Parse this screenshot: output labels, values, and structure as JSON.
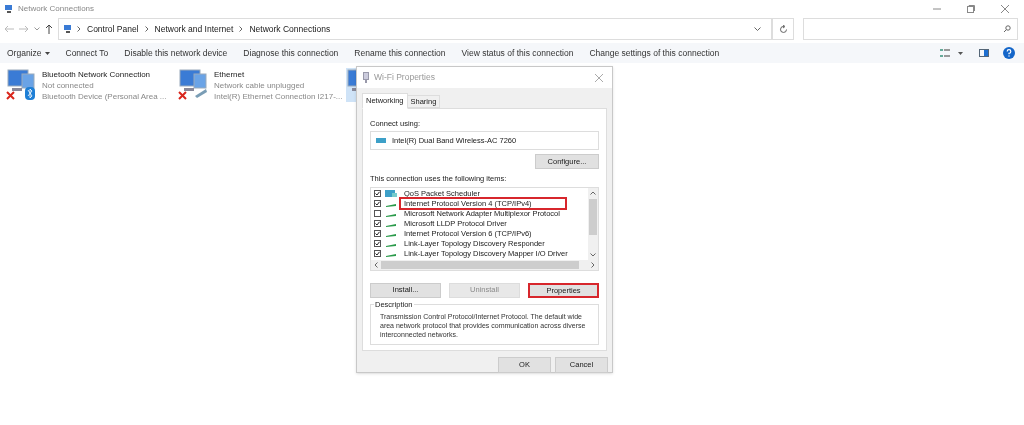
{
  "window": {
    "title": "Network Connections"
  },
  "breadcrumb": [
    "Control Panel",
    "Network and Internet",
    "Network Connections"
  ],
  "commands": [
    {
      "label": "Organize",
      "dropdown": true
    },
    {
      "label": "Connect To",
      "dropdown": false
    },
    {
      "label": "Disable this network device",
      "dropdown": false
    },
    {
      "label": "Diagnose this connection",
      "dropdown": false
    },
    {
      "label": "Rename this connection",
      "dropdown": false
    },
    {
      "label": "View status of this connection",
      "dropdown": false
    },
    {
      "label": "Change settings of this connection",
      "dropdown": false
    }
  ],
  "connections": [
    {
      "name": "Bluetooth Network Connection",
      "status": "Not connected",
      "device": "Bluetooth Device (Personal Area ...",
      "kind": "bluetooth",
      "disconnected": true
    },
    {
      "name": "Ethernet",
      "status": "Network cable unplugged",
      "device": "Intel(R) Ethernet Connection I217-...",
      "kind": "ethernet",
      "disconnected": true
    },
    {
      "kind": "wifi",
      "disconnected": false
    }
  ],
  "dialog": {
    "title": "Wi-Fi Properties",
    "tabs": [
      {
        "label": "Networking",
        "selected": true
      },
      {
        "label": "Sharing",
        "selected": false
      }
    ],
    "connect_using_label": "Connect using:",
    "adapter": "Intel(R) Dual Band Wireless-AC 7260",
    "configure_button": "Configure...",
    "items_label": "This connection uses the following items:",
    "items": [
      {
        "label": "QoS Packet Scheduler",
        "checked": true,
        "highlighted": false,
        "kind": "scheduler"
      },
      {
        "label": "Internet Protocol Version 4 (TCP/IPv4)",
        "checked": true,
        "highlighted": true,
        "kind": "protocol"
      },
      {
        "label": "Microsoft Network Adapter Multiplexor Protocol",
        "checked": false,
        "highlighted": false,
        "kind": "protocol"
      },
      {
        "label": "Microsoft LLDP Protocol Driver",
        "checked": true,
        "highlighted": false,
        "kind": "protocol"
      },
      {
        "label": "Internet Protocol Version 6 (TCP/IPv6)",
        "checked": true,
        "highlighted": false,
        "kind": "protocol"
      },
      {
        "label": "Link-Layer Topology Discovery Responder",
        "checked": true,
        "highlighted": false,
        "kind": "protocol"
      },
      {
        "label": "Link-Layer Topology Discovery Mapper I/O Driver",
        "checked": true,
        "highlighted": false,
        "kind": "protocol"
      }
    ],
    "buttons": [
      {
        "label": "Install...",
        "disabled": false,
        "highlighted": false
      },
      {
        "label": "Uninstall",
        "disabled": true,
        "highlighted": false
      },
      {
        "label": "Properties",
        "disabled": false,
        "highlighted": true
      }
    ],
    "description_label": "Description",
    "description": "Transmission Control Protocol/Internet Protocol. The default wide area network protocol that provides communication across diverse interconnected networks.",
    "footer_buttons": [
      "OK",
      "Cancel"
    ]
  }
}
